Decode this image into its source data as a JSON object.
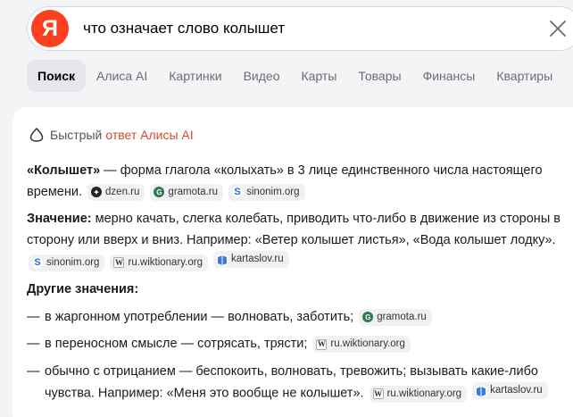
{
  "search": {
    "logo_letter": "Я",
    "query": "что означает слово колышет"
  },
  "tabs": [
    {
      "label": "Поиск",
      "active": true
    },
    {
      "label": "Алиса AI"
    },
    {
      "label": "Картинки"
    },
    {
      "label": "Видео"
    },
    {
      "label": "Карты"
    },
    {
      "label": "Товары"
    },
    {
      "label": "Финансы"
    },
    {
      "label": "Квартиры"
    }
  ],
  "answer": {
    "header_prefix": "Быстрый",
    "header_link": "ответ Алисы AI",
    "intro": {
      "term": "«Колышет»",
      "text": " — форма глагола «колыхать» в 3 лице единственного числа настоящего времени. "
    },
    "meaning": {
      "label": "Значение:",
      "text": " мерно качать, слегка колебать, приводить что-либо в движение из стороны в сторону или вверх и вниз. Например: «Ветер колышет листья», «Вода колышет лодку». "
    },
    "other_label": "Другие значения:",
    "items": [
      {
        "text": "в жаргонном употреблении — волновать, заботить; "
      },
      {
        "text": "в переносном смысле — сотрясать, трясти; "
      },
      {
        "text": "обычно с отрицанием — беспокоить, волновать, тревожить; вызывать какие-либо чувства. Например: «Меня это вообще не колышет». "
      }
    ],
    "sources": {
      "dzen": "dzen.ru",
      "gramota": "gramota.ru",
      "sinonim": "sinonim.org",
      "wiktionary": "ru.wiktionary.org",
      "kartaslov": "kartaslov.ru"
    }
  },
  "colors": {
    "logo": "#fc3f1d",
    "alice_link": "#d24a2d",
    "active_tab": "#e6e6eb"
  }
}
